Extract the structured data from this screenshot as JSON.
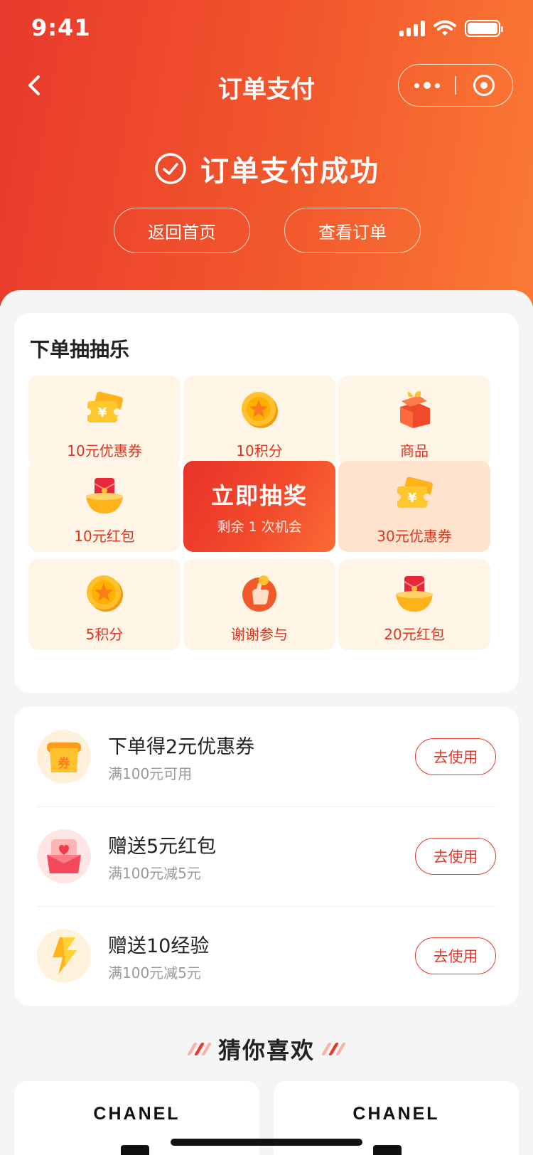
{
  "status_bar": {
    "time": "9:41"
  },
  "nav": {
    "title": "订单支付"
  },
  "hero": {
    "success_text": "订单支付成功",
    "home_button": "返回首页",
    "order_button": "查看订单"
  },
  "lottery": {
    "title": "下单抽抽乐",
    "draw_title": "立即抽奖",
    "draw_subtitle": "剩余 1 次机会",
    "prizes": [
      {
        "label": "10元优惠券",
        "icon": "coupon-ticket-icon"
      },
      {
        "label": "10积分",
        "icon": "star-coin-icon"
      },
      {
        "label": "商品",
        "icon": "gift-box-icon"
      },
      {
        "label": "10元红包",
        "icon": "red-envelope-bowl-icon"
      },
      {
        "label": "30元优惠券",
        "icon": "coupon-ticket-icon"
      },
      {
        "label": "5积分",
        "icon": "star-coin-icon"
      },
      {
        "label": "谢谢参与",
        "icon": "thumb-up-icon"
      },
      {
        "label": "20元红包",
        "icon": "red-envelope-bowl-icon"
      }
    ]
  },
  "rewards": [
    {
      "title": "下单得2元优惠券",
      "subtitle": "满100元可用",
      "button": "去使用",
      "icon": "coupon-scroll-icon"
    },
    {
      "title": "赠送5元红包",
      "subtitle": "满100元减5元",
      "button": "去使用",
      "icon": "red-packet-icon"
    },
    {
      "title": "赠送10经验",
      "subtitle": "满100元减5元",
      "button": "去使用",
      "icon": "lightning-icon"
    }
  ],
  "recommend": {
    "title": "猜你喜欢",
    "products": [
      {
        "brand": "CHANEL"
      },
      {
        "brand": "CHANEL"
      }
    ]
  },
  "colors": {
    "brand_red": "#e5392a",
    "brand_orange": "#fb7a35",
    "cell_bg": "#fff5e6"
  }
}
